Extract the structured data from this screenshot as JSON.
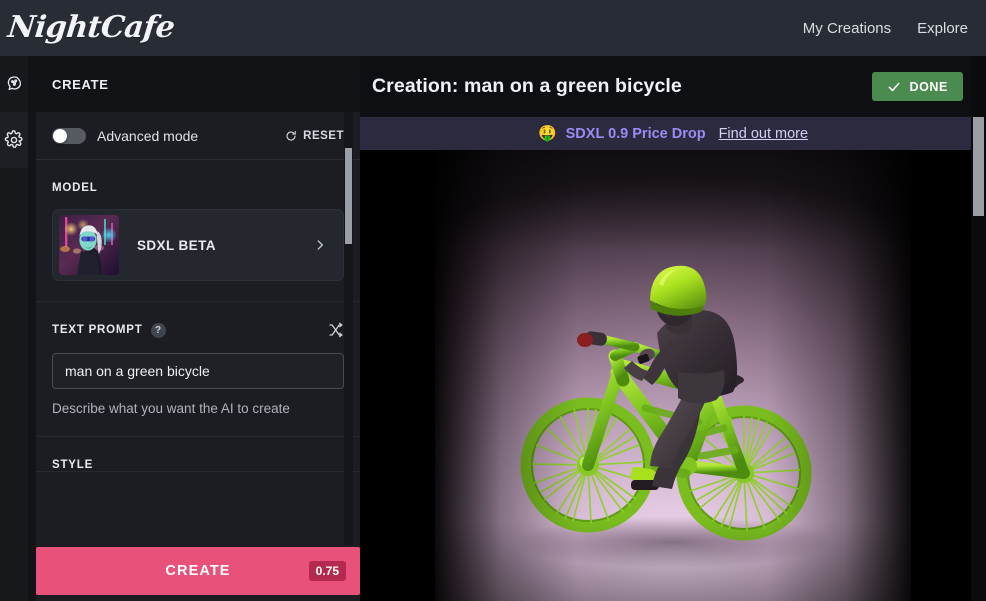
{
  "topbar": {
    "brand": "NightCafe",
    "nav": [
      {
        "label": "My Creations"
      },
      {
        "label": "Explore"
      }
    ]
  },
  "rail": {
    "items": [
      {
        "name": "create-brain-icon",
        "active": false
      },
      {
        "name": "settings-gear-icon",
        "active": true
      }
    ]
  },
  "sidebar": {
    "heading": "CREATE",
    "advanced_mode": {
      "label": "Advanced mode",
      "enabled": false
    },
    "reset_label": "RESET",
    "model": {
      "section_label": "MODEL",
      "name": "SDXL BETA"
    },
    "prompt": {
      "section_label": "TEXT PROMPT",
      "help_glyph": "?",
      "value": "man on a green bicycle",
      "placeholder": "Describe what you want the AI to create",
      "hint": "Describe what you want the AI to create"
    },
    "style": {
      "section_label": "STYLE"
    },
    "create": {
      "label": "CREATE",
      "credits": "0.75"
    }
  },
  "main": {
    "title": "Creation: man on a green bicycle",
    "done_label": "DONE",
    "promo": {
      "emoji": "🤑",
      "text": "SDXL 0.9 Price Drop",
      "link": "Find out more"
    },
    "artwork": {
      "alt": "3D render of a man riding a green bicycle on a pink background"
    }
  },
  "colors": {
    "topbar_bg": "#282c34",
    "sidebar_bg": "#121316",
    "panel_bg": "#1b1d22",
    "create_button": "#e8517a",
    "credits_badge": "#b4294e",
    "done_button": "#4b8b50",
    "promo_bg": "#2b2a3f",
    "promo_text": "#9b8bf4"
  }
}
